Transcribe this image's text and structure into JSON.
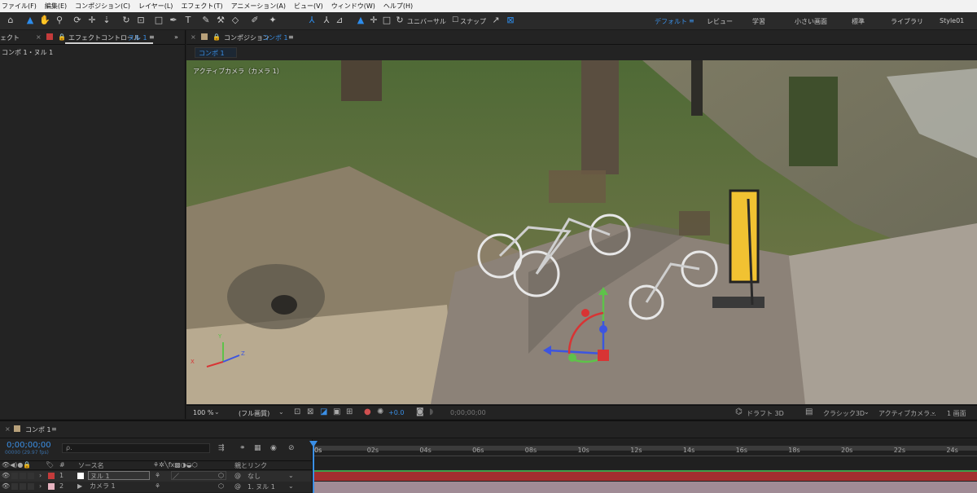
{
  "menu": [
    "ファイル(F)",
    "編集(E)",
    "コンポジション(C)",
    "レイヤー(L)",
    "エフェクト(T)",
    "アニメーション(A)",
    "ビュー(V)",
    "ウィンドウ(W)",
    "ヘルプ(H)"
  ],
  "toolbar": {
    "universal": "ユニバーサル",
    "snap": "スナップ"
  },
  "workspaces": [
    "デフォルト",
    "レビュー",
    "学習",
    "小さい画面",
    "標準",
    "ライブラリ",
    "Style01"
  ],
  "left_panel": {
    "tab_partial": "ェクト",
    "tab_title": "エフェクトコントロール",
    "tab_layer": "ヌル 1",
    "breadcrumb": "コンポ 1・ヌル 1"
  },
  "comp_panel": {
    "tab_prefix": "コンポジション",
    "tab_name": "コンポ 1",
    "sub_tab": "コンポ 1",
    "camera_label": "アクティブカメラ（カメラ 1）"
  },
  "viewer_controls": {
    "zoom": "100 %",
    "resolution": "(フル画質)",
    "exposure": "+0.0",
    "timecode": "0;00;00;00",
    "draft3d": "ドラフト 3D",
    "renderer": "クラシック3D",
    "view": "アクティブカメラ...",
    "layout": "1 画面"
  },
  "timeline": {
    "tab_name": "コンポ 1",
    "current_time": "0;00;00;00",
    "fps_info": "00000 (29.97 fps)",
    "search_placeholder": "ρ.",
    "col_num": "#",
    "col_source": "ソース名",
    "col_parent": "親とリンク",
    "ruler": [
      "0s",
      "02s",
      "04s",
      "06s",
      "08s",
      "10s",
      "12s",
      "14s",
      "16s",
      "18s",
      "20s",
      "22s",
      "24s"
    ],
    "layers": [
      {
        "num": "1",
        "name": "ヌル 1",
        "parent": "なし",
        "label_color": "#c43b3b",
        "bar_color": "#b03030"
      },
      {
        "num": "2",
        "name": "カメラ 1",
        "parent": "1. ヌル 1",
        "label_color": "#e6b3c0",
        "bar_color": "#a38a96"
      }
    ]
  },
  "axis_labels": {
    "x": "X",
    "y": "Y",
    "z": "Z"
  }
}
